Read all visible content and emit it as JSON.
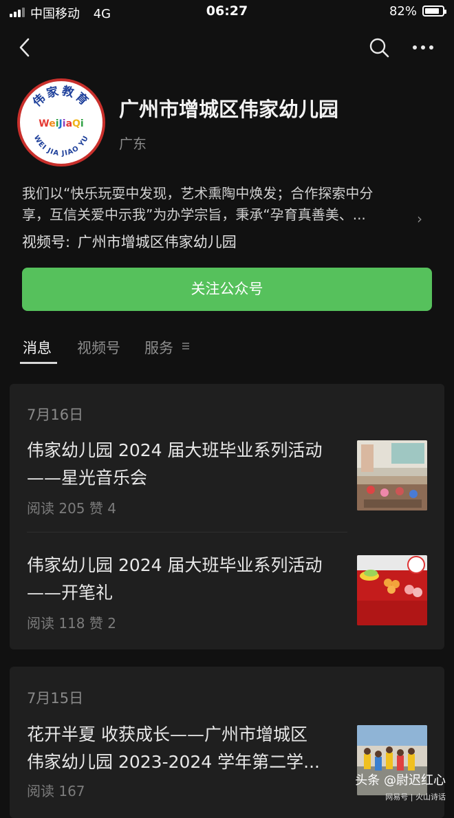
{
  "status_bar": {
    "carrier": "中国移动",
    "network": "4G",
    "time": "06:27",
    "battery": "82%",
    "battery_level": 0.82
  },
  "account": {
    "name": "广州市增城区伟家幼儿园",
    "region": "广东",
    "description_line1": "我们以“快乐玩耍中发现，艺术熏陶中焕发；合作探索中分",
    "description_line2": "享，互信关爱中示我”为办学宗旨，秉承“孕育真善美、...",
    "channel_label": "视频号:",
    "channel_name": "广州市增城区伟家幼儿园",
    "logo_text_top": "伟家教育",
    "logo_text_mid": "WeiJiaQi",
    "logo_text_bottom": "WEI JIA JIAO YU"
  },
  "follow_button": "关注公众号",
  "tabs": [
    {
      "label": "消息",
      "active": true
    },
    {
      "label": "视频号",
      "active": false
    },
    {
      "label": "服务",
      "active": false
    }
  ],
  "groups": [
    {
      "date": "7月16日",
      "articles": [
        {
          "title_line1": "伟家幼儿园 2024 届大班毕业系列活动",
          "title_line2": "——星光音乐会",
          "stats": "阅读 205  赞 4",
          "thumb": "classroom-photo"
        },
        {
          "title_line1": "伟家幼儿园 2024 届大班毕业系列活动",
          "title_line2": "——开笔礼",
          "stats": "阅读 118  赞 2",
          "thumb": "fruit-table-photo"
        }
      ]
    },
    {
      "date": "7月15日",
      "articles": [
        {
          "title_line1": "花开半夏 收获成长——广州市增城区",
          "title_line2": "伟家幼儿园 2023-2024 学年第二学...",
          "stats": "阅读 167",
          "thumb": "children-photo"
        }
      ]
    }
  ],
  "watermark": {
    "main": "头条 @尉迟红心",
    "sub": "网易号 | 火山诗话"
  },
  "colors": {
    "background": "#111111",
    "card": "#1f1f1f",
    "accent_green": "#56c15c",
    "logo_border": "#c9302c"
  }
}
